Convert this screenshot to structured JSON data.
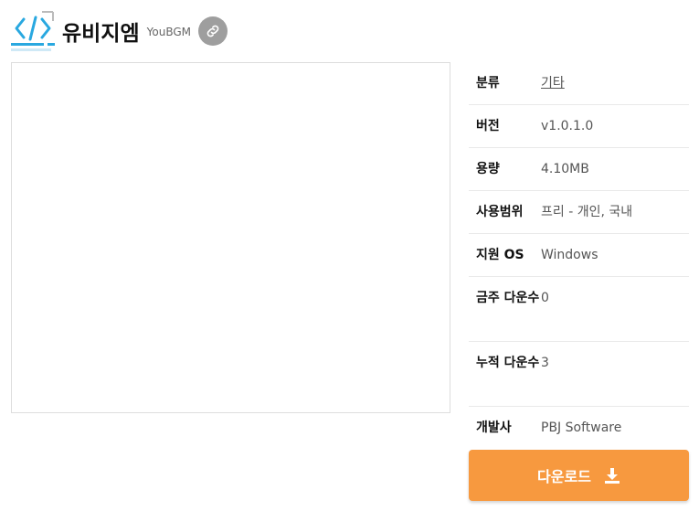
{
  "header": {
    "logo_icon": "code-brackets-icon",
    "title": "유비지엠",
    "subtitle": "YouBGM",
    "link_icon": "link-icon"
  },
  "info": {
    "rows": [
      {
        "label": "분류",
        "value": "기타"
      },
      {
        "label": "버전",
        "value": "v1.0.1.0"
      },
      {
        "label": "용량",
        "value": "4.10MB"
      },
      {
        "label": "사용범위",
        "value": "프리 - 개인, 국내"
      },
      {
        "label": "지원 OS",
        "value": "Windows"
      },
      {
        "label": "금주 다운수",
        "value": "0"
      },
      {
        "label": "누적 다운수",
        "value": "3"
      },
      {
        "label": "개발사",
        "value": "PBJ Software"
      }
    ]
  },
  "download": {
    "label": "다운로드",
    "icon": "download-icon"
  },
  "colors": {
    "accent": "#f7993f",
    "logo_blue": "#29a8e0",
    "link_button": "#9e9e9e"
  }
}
